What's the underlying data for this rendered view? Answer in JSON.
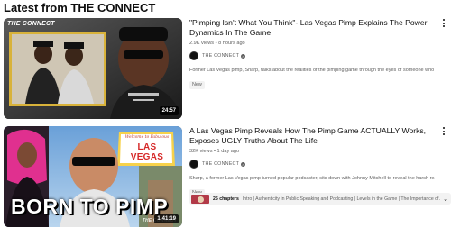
{
  "section": {
    "title": "Latest from THE CONNECT"
  },
  "videos": [
    {
      "title": "\"Pimping Isn't What You Think\"- Las Vegas Pimp Explains The Power Dynamics In The Game",
      "stats": "2.9K views • 8 hours ago",
      "channel": "THE CONNECT",
      "description": "Former Las Vegas pimp, Sharp, talks about the realities of the pimping game through the eyes of someone who lived it",
      "badge": "New",
      "duration": "24:57",
      "thumb_brand": "THE CONNECT"
    },
    {
      "title": "A Las Vegas Pimp Reveals How The Pimp Game ACTUALLY Works, Exposes UGLY Truths About The Life",
      "stats": "32K views • 1 day ago",
      "channel": "THE CONNECT",
      "description": "Sharp, a former Las Vegas pimp turned popular podcaster, sits down with Johnny Mitchell to reveal the harsh realities of pimping ...",
      "badge": "New",
      "duration": "1:41:19",
      "thumb_brand": "THE CONNECT",
      "thumb_headline": "BORN TO PIMP",
      "thumb_sign": "LAS VEGAS",
      "thumb_sign_top": "Welcome to Fabulous",
      "chapters_count": "25 chapters",
      "chapters_list": "Intro | Authenticity in Public Speaking and Podcasting | Levels in the Game | The Importance of..."
    }
  ],
  "colors": {
    "accent_pink": "#d61a8f",
    "text": "#0f0f0f",
    "muted": "#606060",
    "chip_bg": "#f2f2f2"
  }
}
